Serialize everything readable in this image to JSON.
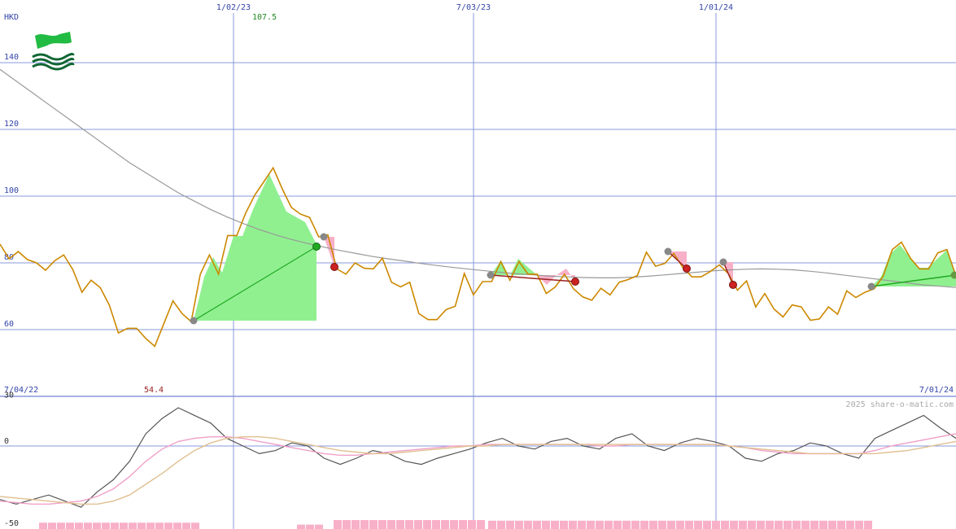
{
  "chart_data": [
    {
      "type": "line",
      "currency": "HKD",
      "x_ticks": [
        "1/02/23",
        "7/03/23",
        "1/01/24"
      ],
      "y_ticks": [
        60,
        80,
        100,
        120,
        140
      ],
      "ylim": [
        50,
        150
      ],
      "range_start": "7/04/22",
      "range_end": "7/01/24",
      "high_label": "107.5",
      "low_label": "54.4",
      "watermark": "2025 share-o-matic.com",
      "grid": true,
      "colors": {
        "price": "#cc8800",
        "moving_average": "#999999",
        "grid": "#8899dd",
        "up_fill": "#90f090",
        "down_fill": "#f8b0c8",
        "up_trend": "#22aa22",
        "down_trend": "#992222",
        "high": "#228822",
        "low": "#992222"
      },
      "price": [
        85.6,
        81.2,
        83.4,
        81,
        80,
        77.8,
        80.6,
        82.4,
        78,
        71.2,
        74.8,
        72.6,
        67.4,
        59,
        60.4,
        60.4,
        57.4,
        55,
        61.8,
        68.6,
        64.8,
        62.4,
        76.6,
        82.4,
        76.6,
        88.2,
        88.2,
        95,
        100.4,
        104.4,
        108.5,
        102.2,
        96.6,
        94.6,
        93.6,
        87.8,
        88.4,
        78.2,
        76.6,
        80,
        78.4,
        78.2,
        81.4,
        74.2,
        72.8,
        74.2,
        64.8,
        63,
        63,
        66,
        67,
        76.8,
        70.4,
        74.4,
        74.4,
        80.4,
        74.8,
        80.4,
        76.6,
        76.6,
        70.8,
        72.8,
        76.6,
        72.2,
        69.8,
        68.8,
        72.4,
        70.4,
        74.2,
        75,
        76.2,
        83.2,
        79,
        79.8,
        82.8,
        78.6,
        75.8,
        75.8,
        77.4,
        79.4,
        76.8,
        71.8,
        74.6,
        66.8,
        70.8,
        66.2,
        63.8,
        67.4,
        66.8,
        62.8,
        63.2,
        66.8,
        64.6,
        71.6,
        69.6,
        71.2,
        72.2,
        76,
        84,
        86.2,
        81.4,
        78.2,
        78.2,
        83,
        84,
        76
      ],
      "moving_average": [
        138,
        134.5,
        131,
        127.5,
        124,
        120.5,
        117,
        113.5,
        110,
        107,
        104,
        101,
        98.5,
        96,
        93.8,
        91.8,
        90,
        88.4,
        87,
        85.8,
        84.7,
        83.7,
        82.8,
        81.9,
        81.2,
        80.5,
        79.8,
        79.2,
        78.6,
        78.1,
        77.6,
        77.1,
        76.7,
        76.4,
        76,
        75.8,
        75.6,
        75.5,
        75.5,
        75.7,
        76,
        76.4,
        76.8,
        77.2,
        77.6,
        77.9,
        78.1,
        78.2,
        78.1,
        77.9,
        77.5,
        77,
        76.4,
        75.8,
        75.2,
        74.6,
        74,
        73.4,
        73,
        72.6
      ]
    },
    {
      "type": "line",
      "y_ticks": [
        30,
        0,
        -50
      ],
      "ylim": [
        -50,
        30
      ],
      "series": [
        {
          "values": [
            -35,
            -38,
            -35,
            -32,
            -36,
            -40,
            -30,
            -22,
            -10,
            8,
            18,
            25,
            20,
            15,
            5,
            0,
            -5,
            -3,
            2,
            0,
            -8,
            -12,
            -8,
            -3,
            -5,
            -10,
            -12,
            -8,
            -5,
            -2,
            2,
            5,
            0,
            -2,
            3,
            5,
            0,
            -2,
            5,
            8,
            0,
            -3,
            2,
            5,
            3,
            0,
            -8,
            -10,
            -5,
            -3,
            2,
            0,
            -5,
            -8,
            5,
            10,
            15,
            20,
            12,
            5
          ]
        },
        {
          "values": [
            -36,
            -37,
            -38,
            -38,
            -37,
            -36,
            -33,
            -28,
            -20,
            -10,
            -2,
            3,
            5,
            6,
            6,
            5,
            3,
            1,
            -1,
            -3,
            -5,
            -6,
            -6,
            -5,
            -4,
            -3,
            -2,
            -1,
            0,
            0,
            1,
            1,
            1,
            1,
            1,
            1,
            1,
            0,
            0,
            1,
            1,
            1,
            1,
            1,
            1,
            0,
            -1,
            -3,
            -4,
            -5,
            -5,
            -5,
            -5,
            -5,
            -3,
            0,
            2,
            4,
            6,
            8
          ]
        },
        {
          "values": [
            -33,
            -34,
            -35,
            -36,
            -37,
            -38,
            -38,
            -36,
            -32,
            -25,
            -18,
            -10,
            -3,
            2,
            5,
            6,
            6,
            5,
            3,
            1,
            -1,
            -3,
            -4,
            -5,
            -5,
            -4,
            -3,
            -2,
            -1,
            0,
            0,
            1,
            1,
            1,
            1,
            1,
            1,
            1,
            1,
            1,
            1,
            1,
            1,
            1,
            1,
            0,
            -1,
            -2,
            -3,
            -4,
            -5,
            -5,
            -5,
            -5,
            -5,
            -4,
            -3,
            -1,
            1,
            3
          ]
        }
      ]
    }
  ]
}
